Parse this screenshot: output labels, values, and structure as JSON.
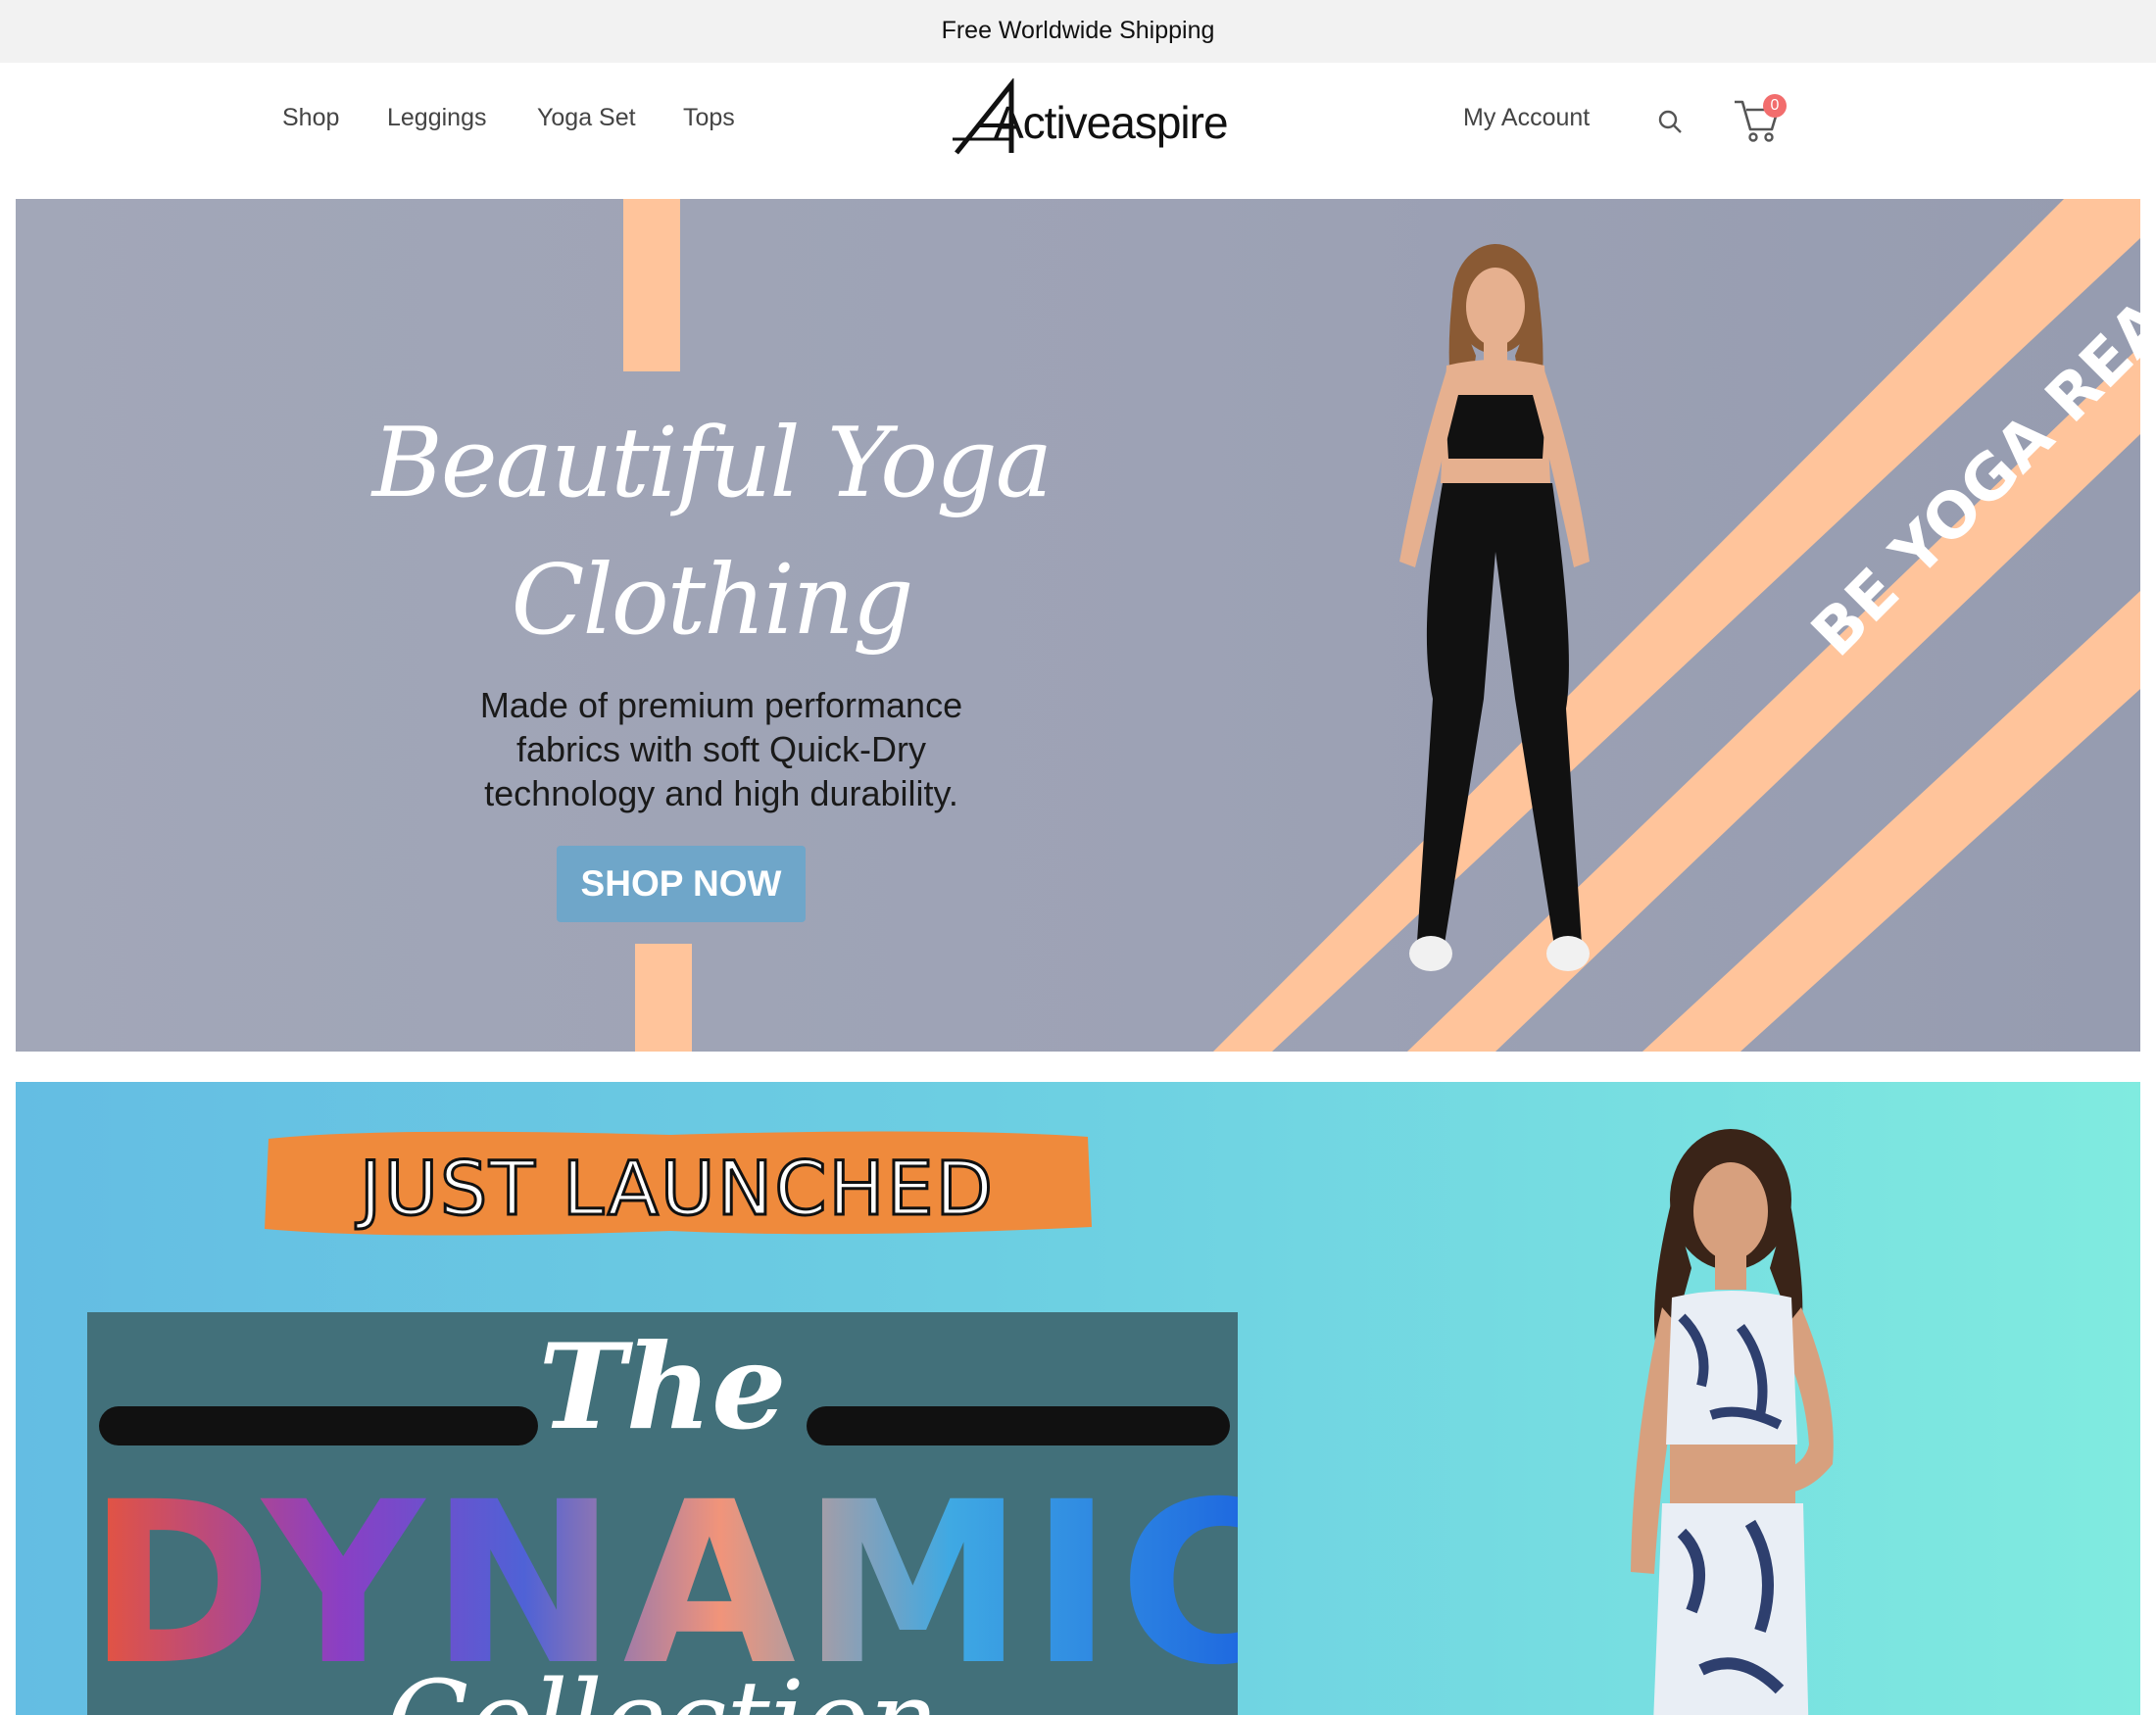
{
  "announcement": {
    "text": "Free Worldwide Shipping"
  },
  "nav": {
    "links": [
      "Shop",
      "Leggings",
      "Yoga Set",
      "Tops"
    ],
    "logo_text": "Activeaspire",
    "account_label": "My Account",
    "cart_count": "0",
    "icons": {
      "search": "search-icon",
      "cart": "cart-icon"
    }
  },
  "hero": {
    "title_line1": "Beautiful Yoga",
    "title_line2": "Clothing",
    "desc_line1": "Made of premium performance",
    "desc_line2": "fabrics with soft Quick-Dry",
    "desc_line3": "technology and high durability.",
    "cta_label": "SHOP NOW",
    "stripe_text": "BE YOGA READY",
    "colors": {
      "background": "#9da2b5",
      "stripe": "#ffc49b",
      "cta": "#6fa6c9"
    }
  },
  "promo": {
    "banner_label": "JUST LAUNCHED",
    "line_the": "The",
    "line_dynamic": "DYNAMIC",
    "line_collection": "Collection",
    "colors": {
      "background": "#6dd0e2",
      "banner": "#ef8a3c",
      "box": "#42707a"
    }
  }
}
